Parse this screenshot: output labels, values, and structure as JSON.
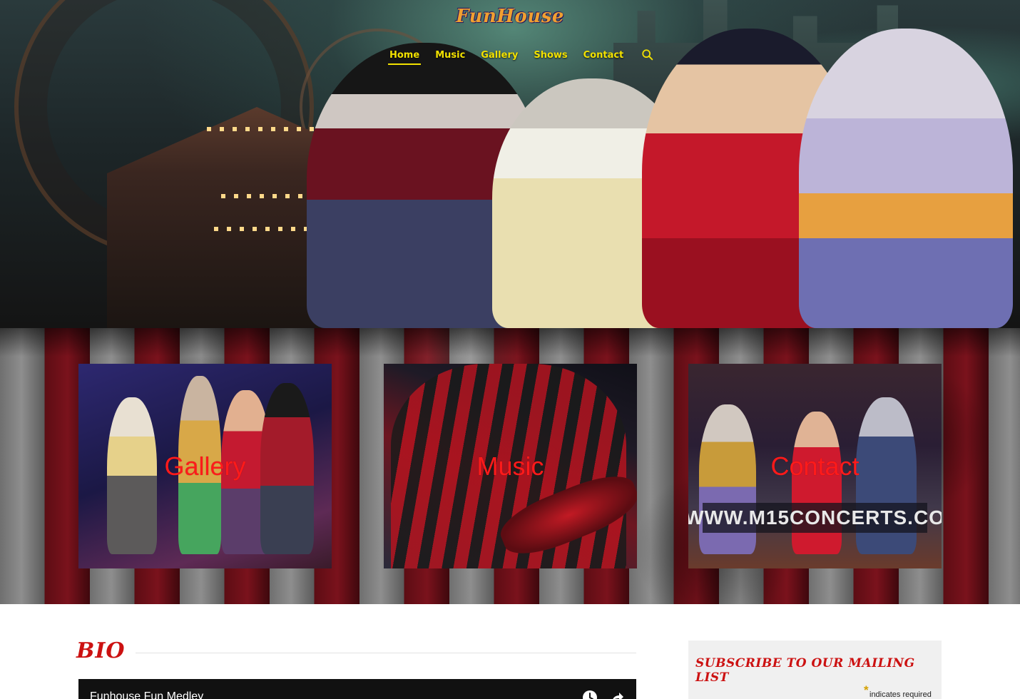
{
  "header": {
    "logo_text": "FunHouse",
    "nav": [
      {
        "label": "Home",
        "active": true
      },
      {
        "label": "Music",
        "active": false
      },
      {
        "label": "Gallery",
        "active": false
      },
      {
        "label": "Shows",
        "active": false
      },
      {
        "label": "Contact",
        "active": false
      }
    ],
    "search_icon": "search-icon",
    "nav_color": "#f2e100"
  },
  "promo_cards": [
    {
      "label": "Gallery"
    },
    {
      "label": "Music"
    },
    {
      "label": "Contact",
      "banner": "WWW.M15CONCERTS.CO"
    }
  ],
  "bio": {
    "title": "BIO",
    "video": {
      "title": "Funhouse Fun Medley",
      "icons": [
        "clock-icon",
        "share-icon"
      ]
    }
  },
  "sidebar": {
    "subscribe_title": "SUBSCRIBE TO OUR MAILING LIST",
    "required_marker": "*",
    "required_text": "indicates required"
  },
  "colors": {
    "accent_red": "#cc1111",
    "card_label_red": "#ff1a1a"
  }
}
